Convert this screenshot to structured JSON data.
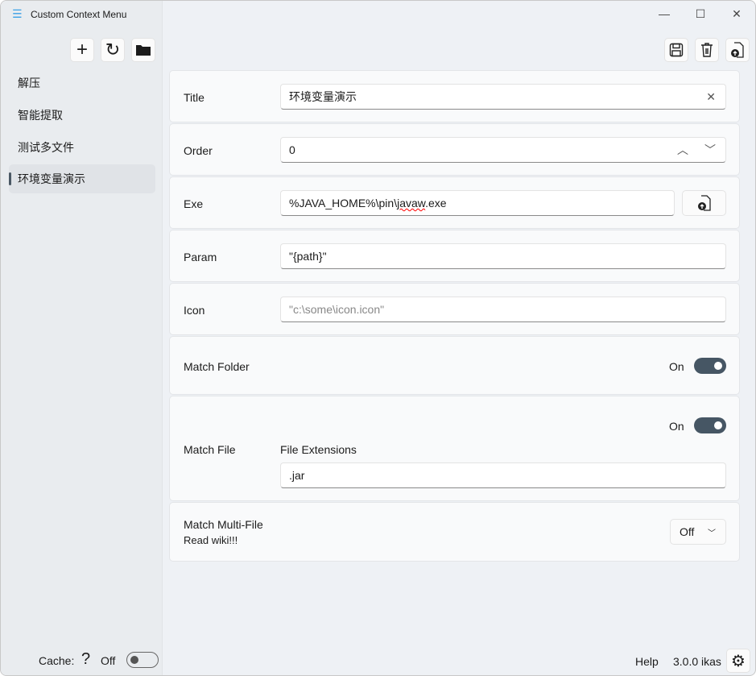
{
  "app": {
    "title": "Custom Context Menu"
  },
  "sidebar": {
    "items": [
      {
        "label": "解压"
      },
      {
        "label": "智能提取"
      },
      {
        "label": "测试多文件"
      },
      {
        "label": "环境变量演示"
      }
    ],
    "cache_label": "Cache:",
    "cache_help": "?",
    "cache_state": "Off"
  },
  "form": {
    "title_label": "Title",
    "title_value": "环境变量演示",
    "order_label": "Order",
    "order_value": "0",
    "exe_label": "Exe",
    "exe_value_a": "%JAVA_HOME%\\pin\\",
    "exe_value_b": "javaw",
    ".exe": ".exe",
    "param_label": "Param",
    "param_value": "\"{path}\"",
    "icon_label": "Icon",
    "icon_placeholder": "\"c:\\some\\icon.icon\"",
    "match_folder_label": "Match Folder",
    "match_folder_state": "On",
    "match_file_label": "Match File",
    "match_file_state": "On",
    "file_ext_label": "File Extensions",
    "file_ext_value": ".jar",
    "multi_label": "Match Multi-File",
    "multi_note": "Read wiki!!!",
    "multi_value": "Off"
  },
  "footer": {
    "help": "Help",
    "version": "3.0.0 ikas"
  }
}
